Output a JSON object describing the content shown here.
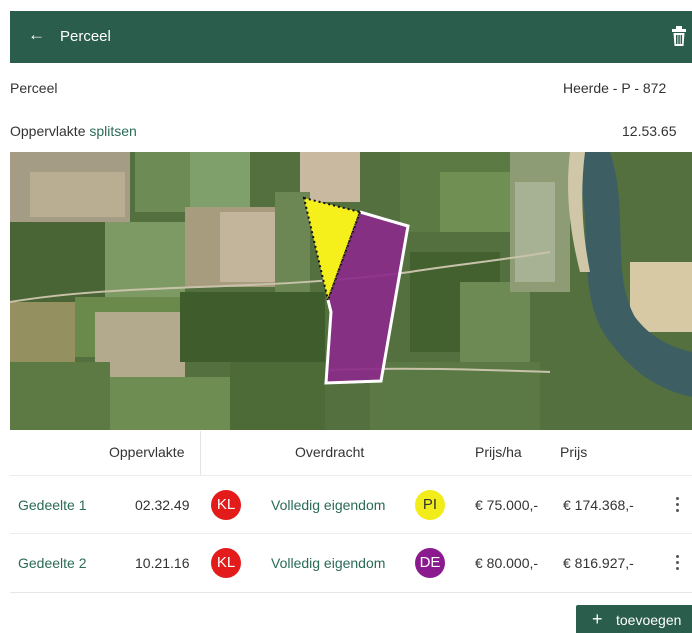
{
  "header": {
    "back_icon": "arrow-left-icon",
    "title": "Perceel",
    "trash_icon": "trash-icon"
  },
  "info": {
    "perceel_label": "Perceel",
    "perceel_value": "Heerde - P - 872",
    "area_label": "Oppervlakte",
    "split_link": "splitsen",
    "area_value": "12.53.65"
  },
  "table": {
    "headers": {
      "area": "Oppervlakte",
      "transfer": "Overdracht",
      "price_ha": "Prijs/ha",
      "price": "Prijs"
    },
    "rows": [
      {
        "name": "Gedeelte 1",
        "area": "02.32.49",
        "badge1": "KL",
        "badge1_color": "#e31b1b",
        "transfer": "Volledig eigendom",
        "badge2": "PI",
        "badge2_color": "#f2ec1a",
        "price_ha": "€ 75.000,-",
        "price": "€ 174.368,-"
      },
      {
        "name": "Gedeelte 2",
        "area": "10.21.16",
        "badge1": "KL",
        "badge1_color": "#e31b1b",
        "transfer": "Volledig eigendom",
        "badge2": "DE",
        "badge2_color": "#8a1a8e",
        "price_ha": "€ 80.000,-",
        "price": "€ 816.927,-"
      }
    ]
  },
  "add_button": {
    "icon": "plus-icon",
    "label": "toevoegen"
  },
  "colors": {
    "primary": "#2a5d4c",
    "link": "#2a6b57",
    "parcel_yellow": "#f5ef1c",
    "parcel_purple": "#8b2a8a"
  }
}
